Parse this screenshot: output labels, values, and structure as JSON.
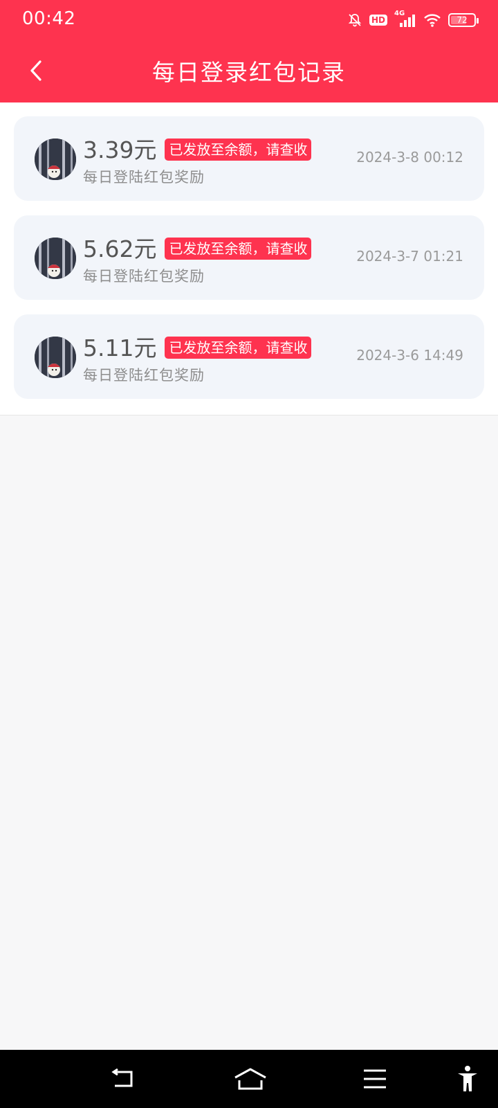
{
  "status_bar": {
    "time": "00:42",
    "network": "4G",
    "hd": "HD",
    "battery_level": "72",
    "battery_percent": 72
  },
  "header": {
    "title": "每日登录红包记录",
    "back_icon": "chevron-left-icon"
  },
  "records": [
    {
      "amount": "3.39元",
      "status": "已发放至余额，请查收",
      "description": "每日登陆红包奖励",
      "time": "2024-3-8 00:12"
    },
    {
      "amount": "5.62元",
      "status": "已发放至余额，请查收",
      "description": "每日登陆红包奖励",
      "time": "2024-3-7 01:21"
    },
    {
      "amount": "5.11元",
      "status": "已发放至余额，请查收",
      "description": "每日登陆红包奖励",
      "time": "2024-3-6 14:49"
    }
  ],
  "nav_bar": {
    "icons": [
      "back-icon",
      "home-icon",
      "menu-icon",
      "accessibility-icon"
    ]
  },
  "colors": {
    "accent": "#fe334f",
    "card_bg": "#f2f5fa",
    "page_bg": "#f7f7f8"
  }
}
